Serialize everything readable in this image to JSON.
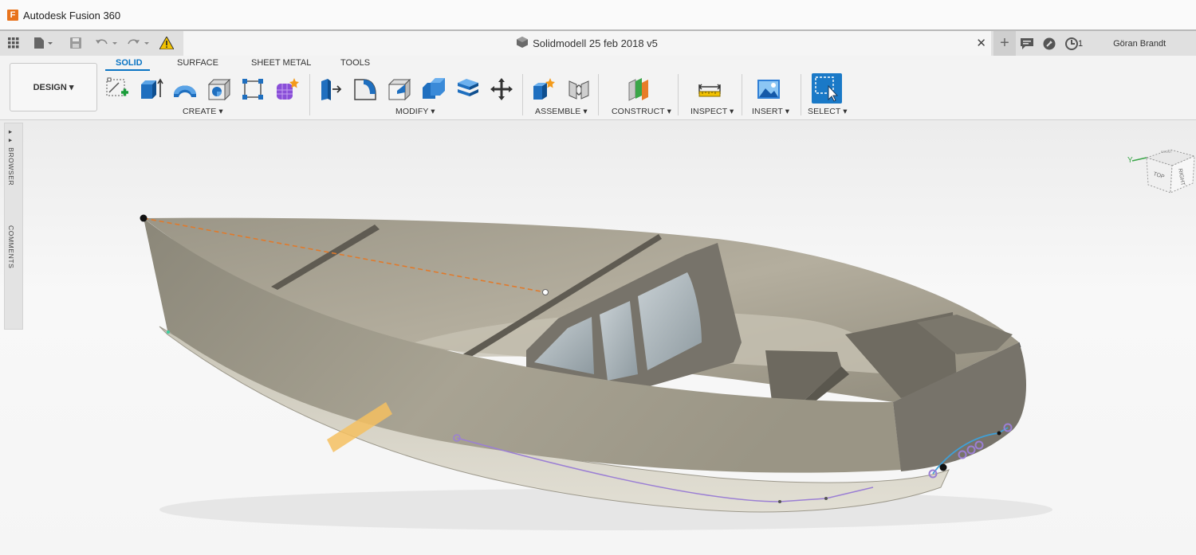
{
  "app": {
    "logo_letter": "F",
    "title": "Autodesk Fusion 360"
  },
  "document": {
    "title": "Solidmodell 25 feb 2018 v5"
  },
  "header": {
    "job_count": "1",
    "user_name": "Göran Brandt"
  },
  "workspace": {
    "label": "DESIGN ▾"
  },
  "ribbon_tabs": [
    "SOLID",
    "SURFACE",
    "SHEET METAL",
    "TOOLS"
  ],
  "groups": {
    "create": "CREATE ▾",
    "modify": "MODIFY ▾",
    "assemble": "ASSEMBLE ▾",
    "construct": "CONSTRUCT ▾",
    "inspect": "INSPECT ▾",
    "insert": "INSERT ▾",
    "select": "SELECT ▾"
  },
  "side_panel": {
    "browser": "BROWSER",
    "comments": "COMMENTS"
  },
  "viewcube": {
    "axis_y": "Y",
    "face_top": "TOP",
    "face_right": "RIGHT",
    "face_front": "FRONT"
  },
  "colors": {
    "accent": "#0a74c4",
    "logo": "#e8731c",
    "hull": "#8f8a7d",
    "sketch_curve": "#9b7fd4",
    "spline": "#3fa0d8"
  }
}
